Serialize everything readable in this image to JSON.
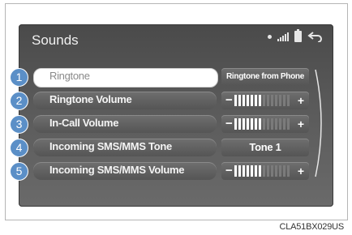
{
  "screen": {
    "title": "Sounds",
    "status_icons": [
      "bluetooth-dot-icon",
      "signal-icon",
      "battery-icon",
      "back-arrow-icon"
    ]
  },
  "rows": [
    {
      "number": "1",
      "label": "Ringtone",
      "value": "Ringtone from Phone",
      "selected": true
    },
    {
      "number": "2",
      "label": "Ringtone Volume",
      "volume_level": 0.5
    },
    {
      "number": "3",
      "label": "In-Call Volume",
      "volume_level": 0.5
    },
    {
      "number": "4",
      "label": "Incoming SMS/MMS Tone",
      "value": "Tone 1"
    },
    {
      "number": "5",
      "label": "Incoming SMS/MMS Volume",
      "volume_level": 0.5
    }
  ],
  "volume_controls": {
    "minus": "−",
    "plus": "+"
  },
  "caption": "CLA51BX029US",
  "colors": {
    "badge": "#5b8fc7",
    "screen_bg": "#555555"
  }
}
